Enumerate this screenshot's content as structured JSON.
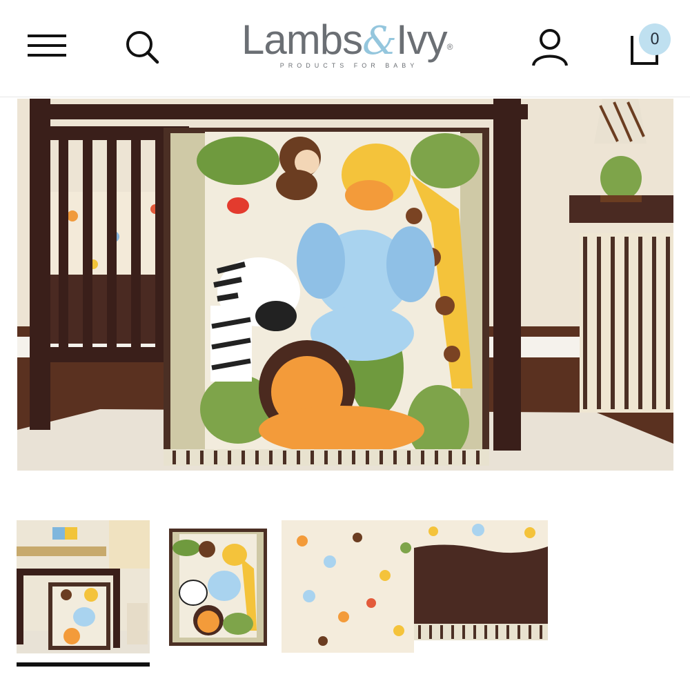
{
  "header": {
    "menu_icon": "hamburger-menu-icon",
    "search_icon": "search-icon",
    "account_icon": "user-icon",
    "cart_icon": "shopping-bag-icon",
    "cart_count": "0",
    "logo": {
      "brand_left": "Lambs",
      "brand_amp": "&",
      "brand_right": "Ivy",
      "registered": "®",
      "tagline": "PRODUCTS FOR BABY"
    }
  },
  "gallery": {
    "main_image": "jungle-animal-crib-bedding-set",
    "thumbnails": [
      {
        "name": "nursery-room-view",
        "active": true
      },
      {
        "name": "quilt-closeup",
        "active": false
      },
      {
        "name": "sheet-and-crib-skirt",
        "active": false
      }
    ]
  },
  "colors": {
    "badge": "#bfe0f0",
    "logo_gray": "#6b6f74",
    "logo_blue": "#94c6dd",
    "crib_wood": "#3a1f1a"
  }
}
